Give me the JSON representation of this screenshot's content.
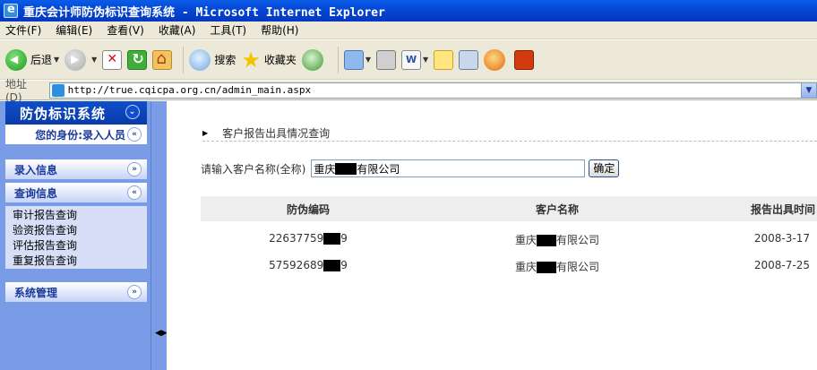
{
  "window": {
    "title": "重庆会计师防伪标识查询系统 - Microsoft Internet Explorer"
  },
  "menu": [
    "文件(F)",
    "编辑(E)",
    "查看(V)",
    "收藏(A)",
    "工具(T)",
    "帮助(H)"
  ],
  "toolbar": {
    "back": "后退",
    "search": "搜索",
    "favorites": "收藏夹"
  },
  "address": {
    "label": "地址(D)",
    "url": "http://true.cqicpa.org.cn/admin_main.aspx"
  },
  "sidebar": {
    "title": "防伪标识系统",
    "identity": "您的身份:录入人员",
    "sections": [
      {
        "label": "录入信息"
      },
      {
        "label": "查询信息"
      },
      {
        "label": "系统管理"
      }
    ],
    "query_links": [
      "审计报告查询",
      "验资报告查询",
      "评估报告查询",
      "重复报告查询"
    ]
  },
  "content": {
    "section_title": "客户报告出具情况查询",
    "search_label": "请输入客户名称(全称)",
    "search_value_prefix": "重庆",
    "search_value_suffix": "有限公司",
    "confirm_label": "确定",
    "columns": [
      "防伪编码",
      "客户名称",
      "报告出具时间"
    ],
    "rows": [
      {
        "code_prefix": "22637759",
        "code_suffix": "9",
        "client_prefix": "重庆",
        "client_suffix": "有限公司",
        "date": "2008-3-17"
      },
      {
        "code_prefix": "57592689",
        "code_suffix": "9",
        "client_prefix": "重庆",
        "client_suffix": "有限公司",
        "date": "2008-7-25"
      }
    ]
  }
}
